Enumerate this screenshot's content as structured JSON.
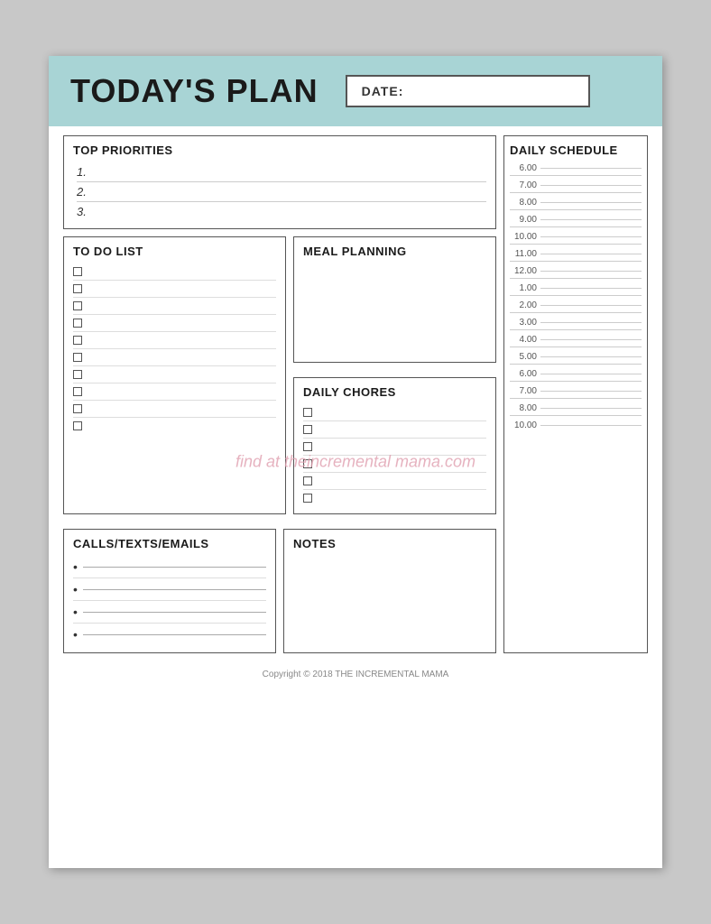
{
  "header": {
    "title": "TODAY'S PLAN",
    "date_label": "DATE:"
  },
  "top_priorities": {
    "title": "TOP PRIORITIES",
    "items": [
      "1.",
      "2.",
      "3."
    ]
  },
  "daily_schedule": {
    "title": "DAILY SCHEDULE",
    "times": [
      "6.00",
      "7.00",
      "8.00",
      "9.00",
      "10.00",
      "11.00",
      "12.00",
      "1.00",
      "2.00",
      "3.00",
      "4.00",
      "5.00",
      "6.00",
      "7.00",
      "8.00",
      "10.00"
    ]
  },
  "todo": {
    "title": "TO DO LIST",
    "items_count": 10
  },
  "meal_planning": {
    "title": "MEAL PLANNING"
  },
  "daily_chores": {
    "title": "DAILY CHORES",
    "items_count": 6
  },
  "calls": {
    "title": "CALLS/TEXTS/EMAILS",
    "items_count": 4
  },
  "notes": {
    "title": "NOTES"
  },
  "watermark": "find at theincremental mama.com",
  "copyright": "Copyright © 2018 THE INCREMENTAL MAMA"
}
